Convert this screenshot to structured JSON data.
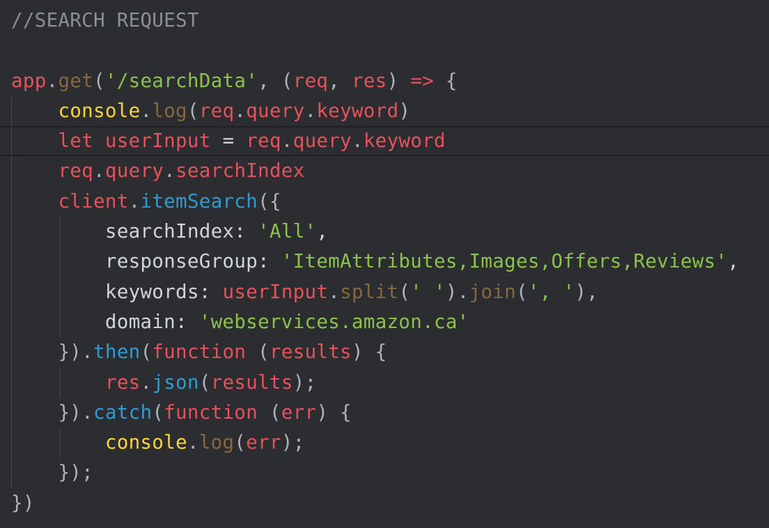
{
  "colors": {
    "background": "#2b2d31",
    "default": "#d1d4d8",
    "comment": "#8b9098",
    "keyword": "#e8505b",
    "variable": "#e8505b",
    "method_call": "#86683f",
    "method_def": "#2f9cd1",
    "string": "#8bc34a",
    "object": "#ffd43b",
    "punctuation": "#b0b4ba",
    "param": "#e8505b",
    "active_line_border": "#1e2023",
    "indent_guide": "#45484e"
  },
  "editor": {
    "active_line": 4,
    "lines": [
      {
        "indent": 0,
        "tokens": [
          {
            "t": "//SEARCH REQUEST",
            "c": "comment"
          }
        ]
      },
      {
        "indent": 0,
        "tokens": []
      },
      {
        "indent": 0,
        "tokens": [
          {
            "t": "app",
            "c": "variable"
          },
          {
            "t": ".",
            "c": "punctuation"
          },
          {
            "t": "get",
            "c": "method_call"
          },
          {
            "t": "(",
            "c": "punctuation"
          },
          {
            "t": "'/searchData'",
            "c": "string"
          },
          {
            "t": ", ",
            "c": "punctuation"
          },
          {
            "t": "(",
            "c": "punctuation"
          },
          {
            "t": "req",
            "c": "param"
          },
          {
            "t": ", ",
            "c": "punctuation"
          },
          {
            "t": "res",
            "c": "param"
          },
          {
            "t": ") ",
            "c": "punctuation"
          },
          {
            "t": "=>",
            "c": "keyword"
          },
          {
            "t": " {",
            "c": "punctuation"
          }
        ]
      },
      {
        "indent": 1,
        "tokens": [
          {
            "t": "console",
            "c": "object"
          },
          {
            "t": ".",
            "c": "punctuation"
          },
          {
            "t": "log",
            "c": "method_call"
          },
          {
            "t": "(",
            "c": "punctuation"
          },
          {
            "t": "req",
            "c": "variable"
          },
          {
            "t": ".",
            "c": "punctuation"
          },
          {
            "t": "query",
            "c": "variable"
          },
          {
            "t": ".",
            "c": "punctuation"
          },
          {
            "t": "keyword",
            "c": "variable"
          },
          {
            "t": ")",
            "c": "punctuation"
          }
        ]
      },
      {
        "indent": 1,
        "tokens": [
          {
            "t": "let ",
            "c": "keyword"
          },
          {
            "t": "userInput",
            "c": "variable"
          },
          {
            "t": " = ",
            "c": "default"
          },
          {
            "t": "req",
            "c": "variable"
          },
          {
            "t": ".",
            "c": "punctuation"
          },
          {
            "t": "query",
            "c": "variable"
          },
          {
            "t": ".",
            "c": "punctuation"
          },
          {
            "t": "keyword",
            "c": "variable"
          }
        ]
      },
      {
        "indent": 1,
        "tokens": [
          {
            "t": "req",
            "c": "variable"
          },
          {
            "t": ".",
            "c": "punctuation"
          },
          {
            "t": "query",
            "c": "variable"
          },
          {
            "t": ".",
            "c": "punctuation"
          },
          {
            "t": "searchIndex",
            "c": "variable"
          }
        ]
      },
      {
        "indent": 1,
        "tokens": [
          {
            "t": "client",
            "c": "variable"
          },
          {
            "t": ".",
            "c": "punctuation"
          },
          {
            "t": "itemSearch",
            "c": "method_def"
          },
          {
            "t": "({",
            "c": "punctuation"
          }
        ]
      },
      {
        "indent": 2,
        "tokens": [
          {
            "t": "searchIndex",
            "c": "default"
          },
          {
            "t": ": ",
            "c": "default"
          },
          {
            "t": "'All'",
            "c": "string"
          },
          {
            "t": ",",
            "c": "default"
          }
        ]
      },
      {
        "indent": 2,
        "tokens": [
          {
            "t": "responseGroup",
            "c": "default"
          },
          {
            "t": ": ",
            "c": "default"
          },
          {
            "t": "'ItemAttributes,Images,Offers,Reviews'",
            "c": "string"
          },
          {
            "t": ",",
            "c": "default"
          }
        ]
      },
      {
        "indent": 2,
        "tokens": [
          {
            "t": "keywords",
            "c": "default"
          },
          {
            "t": ": ",
            "c": "default"
          },
          {
            "t": "userInput",
            "c": "variable"
          },
          {
            "t": ".",
            "c": "punctuation"
          },
          {
            "t": "split",
            "c": "method_call"
          },
          {
            "t": "(",
            "c": "punctuation"
          },
          {
            "t": "' '",
            "c": "string"
          },
          {
            "t": ").",
            "c": "punctuation"
          },
          {
            "t": "join",
            "c": "method_call"
          },
          {
            "t": "(",
            "c": "punctuation"
          },
          {
            "t": "', '",
            "c": "string"
          },
          {
            "t": "),",
            "c": "punctuation"
          }
        ]
      },
      {
        "indent": 2,
        "tokens": [
          {
            "t": "domain",
            "c": "default"
          },
          {
            "t": ": ",
            "c": "default"
          },
          {
            "t": "'webservices.amazon.ca'",
            "c": "string"
          }
        ]
      },
      {
        "indent": 1,
        "tokens": [
          {
            "t": "})",
            "c": "punctuation"
          },
          {
            "t": ".",
            "c": "punctuation"
          },
          {
            "t": "then",
            "c": "method_def"
          },
          {
            "t": "(",
            "c": "punctuation"
          },
          {
            "t": "function",
            "c": "keyword"
          },
          {
            "t": " (",
            "c": "punctuation"
          },
          {
            "t": "results",
            "c": "param"
          },
          {
            "t": ") {",
            "c": "punctuation"
          }
        ]
      },
      {
        "indent": 2,
        "tokens": [
          {
            "t": "res",
            "c": "variable"
          },
          {
            "t": ".",
            "c": "punctuation"
          },
          {
            "t": "json",
            "c": "method_def"
          },
          {
            "t": "(",
            "c": "punctuation"
          },
          {
            "t": "results",
            "c": "variable"
          },
          {
            "t": ");",
            "c": "punctuation"
          }
        ]
      },
      {
        "indent": 1,
        "tokens": [
          {
            "t": "})",
            "c": "punctuation"
          },
          {
            "t": ".",
            "c": "punctuation"
          },
          {
            "t": "catch",
            "c": "method_def"
          },
          {
            "t": "(",
            "c": "punctuation"
          },
          {
            "t": "function",
            "c": "keyword"
          },
          {
            "t": " (",
            "c": "punctuation"
          },
          {
            "t": "err",
            "c": "param"
          },
          {
            "t": ") {",
            "c": "punctuation"
          }
        ]
      },
      {
        "indent": 2,
        "tokens": [
          {
            "t": "console",
            "c": "object"
          },
          {
            "t": ".",
            "c": "punctuation"
          },
          {
            "t": "log",
            "c": "method_call"
          },
          {
            "t": "(",
            "c": "punctuation"
          },
          {
            "t": "err",
            "c": "variable"
          },
          {
            "t": ");",
            "c": "punctuation"
          }
        ]
      },
      {
        "indent": 1,
        "tokens": [
          {
            "t": "});",
            "c": "punctuation"
          }
        ]
      },
      {
        "indent": 0,
        "tokens": [
          {
            "t": "})",
            "c": "punctuation"
          }
        ]
      }
    ]
  }
}
